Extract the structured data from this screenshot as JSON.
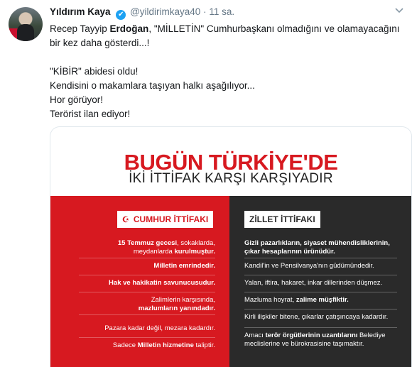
{
  "author": {
    "name": "Yıldırım Kaya",
    "handle": "@yildirimkaya40",
    "separator": "·",
    "time": "11 sa.",
    "verified_mark": "✔"
  },
  "icons": {
    "menu": "chevron-down-icon",
    "verified": "verified-badge-icon"
  },
  "colors": {
    "brand_red": "#d71920",
    "dark_panel": "#2a2a2a",
    "link_blue": "#1da1f2"
  },
  "tweet": {
    "line1_pre": "Recep Tayyip ",
    "line1_bold": "Erdoğan",
    "line1_post": ", \"MİLLETİN\" Cumhurbaşkanı olmadığını ve olamayacağını",
    "line2": "bir kez daha gösterdi...!",
    "line3": "\"KİBİR\" abidesi oldu!",
    "line4": "Kendisini o makamlara taşıyan halkı aşağılıyor...",
    "line5": "Hor görüyor!",
    "line6": "Terörist ilan ediyor!"
  },
  "card": {
    "title": "BUGÜN TÜRKİYE'DE",
    "subtitle": "İKİ İTTİFAK KARŞI KARŞIYADIR",
    "left": {
      "tag": "CUMHUR İTTİFAKI",
      "tag_icon": "☪",
      "i1_a": "15 Temmuz gecesi",
      "i1_b": ", sokaklarda,",
      "i1_c": "meydanlarda ",
      "i1_d": "kurulmuştur.",
      "i2": "Milletin emrindedir.",
      "i3": "Hak ve hakikatin savunucusudur.",
      "i4_a": "Zalimlerin karşısında,",
      "i4_b": "mazlumların yanındadır.",
      "i5": "Pazara kadar değil, mezara kadardır.",
      "i6_a": "Sadece ",
      "i6_b": "Milletin hizmetine",
      "i6_c": " taliptir."
    },
    "right": {
      "tag": "ZİLLET İTTİFAKI",
      "i1_a": "Gizli pazarlıkların, siyaset mühendisliklerinin,",
      "i1_b": "çıkar hesaplarının ürünüdür.",
      "i2": "Kandil'in ve Pensilvanya'nın güdümündedir.",
      "i3": "Yalan, iftira, hakaret, inkar dillerinden düşmez.",
      "i4_a": "Mazluma hoyrat, ",
      "i4_b": "zalime müşfiktir.",
      "i5": "Kirli ilişkiler bitene, çıkarlar çatışıncaya kadardır.",
      "i6_a": "Amacı ",
      "i6_b": "terör örgütlerinin uzantılarını",
      "i6_c": " Belediye",
      "i6_d": "meclislerine ve bürokrasisine taşımaktır."
    }
  }
}
